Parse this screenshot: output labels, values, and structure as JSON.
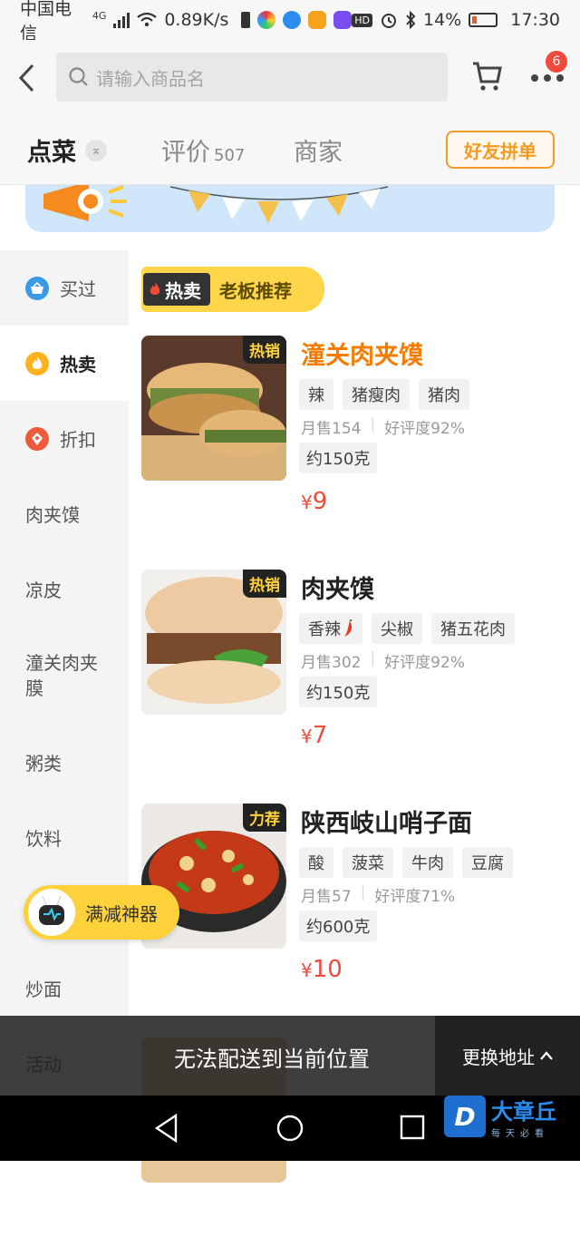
{
  "status_bar": {
    "carrier": "中国电信",
    "network": "4G",
    "speed": "0.89K/s",
    "battery": "14%",
    "time": "17:30"
  },
  "header": {
    "search_placeholder": "请输入商品名",
    "cart_badge": "6"
  },
  "tabs": {
    "order": "点菜",
    "reviews": "评价",
    "reviews_count": "507",
    "merchant": "商家",
    "group_button": "好友拼单"
  },
  "sidebar": {
    "items": [
      {
        "label": "买过",
        "icon": "basket-icon"
      },
      {
        "label": "热卖",
        "icon": "flame-icon"
      },
      {
        "label": "折扣",
        "icon": "discount-icon"
      },
      {
        "label": "肉夹馍"
      },
      {
        "label": "凉皮"
      },
      {
        "label": "潼关肉夹膜"
      },
      {
        "label": "粥类"
      },
      {
        "label": "饮料"
      },
      {
        "label": "炒面"
      },
      {
        "label": "活动"
      }
    ]
  },
  "section": {
    "tag": "热卖",
    "title": "老板推荐"
  },
  "dishes": [
    {
      "ribbon": "热销",
      "name": "潼关肉夹馍",
      "tags": [
        "辣",
        "猪瘦肉",
        "猪肉"
      ],
      "monthly_sales": "月售154",
      "rating": "好评度92%",
      "weight": "约150克",
      "currency": "¥",
      "price": "9"
    },
    {
      "ribbon": "热销",
      "name": "肉夹馍",
      "tags": [
        "香辣",
        "尖椒",
        "猪五花肉"
      ],
      "monthly_sales": "月售302",
      "rating": "好评度92%",
      "weight": "约150克",
      "currency": "¥",
      "price": "7"
    },
    {
      "ribbon": "力荐",
      "name": "陕西岐山哨子面",
      "tags": [
        "酸",
        "菠菜",
        "牛肉",
        "豆腐"
      ],
      "monthly_sales": "月售57",
      "rating": "好评度71%",
      "weight": "约600克",
      "currency": "¥",
      "price": "10"
    }
  ],
  "helper": {
    "label": "满减神器"
  },
  "notice": {
    "message": "无法配送到当前位置",
    "change_address": "更换地址"
  },
  "watermark": {
    "logo_letter": "D",
    "title": "大章丘",
    "subtitle": "每天必看"
  },
  "colors": {
    "accent_orange": "#f59b23",
    "price_red": "#f24a3a",
    "highlight_yellow": "#ffd54a"
  }
}
